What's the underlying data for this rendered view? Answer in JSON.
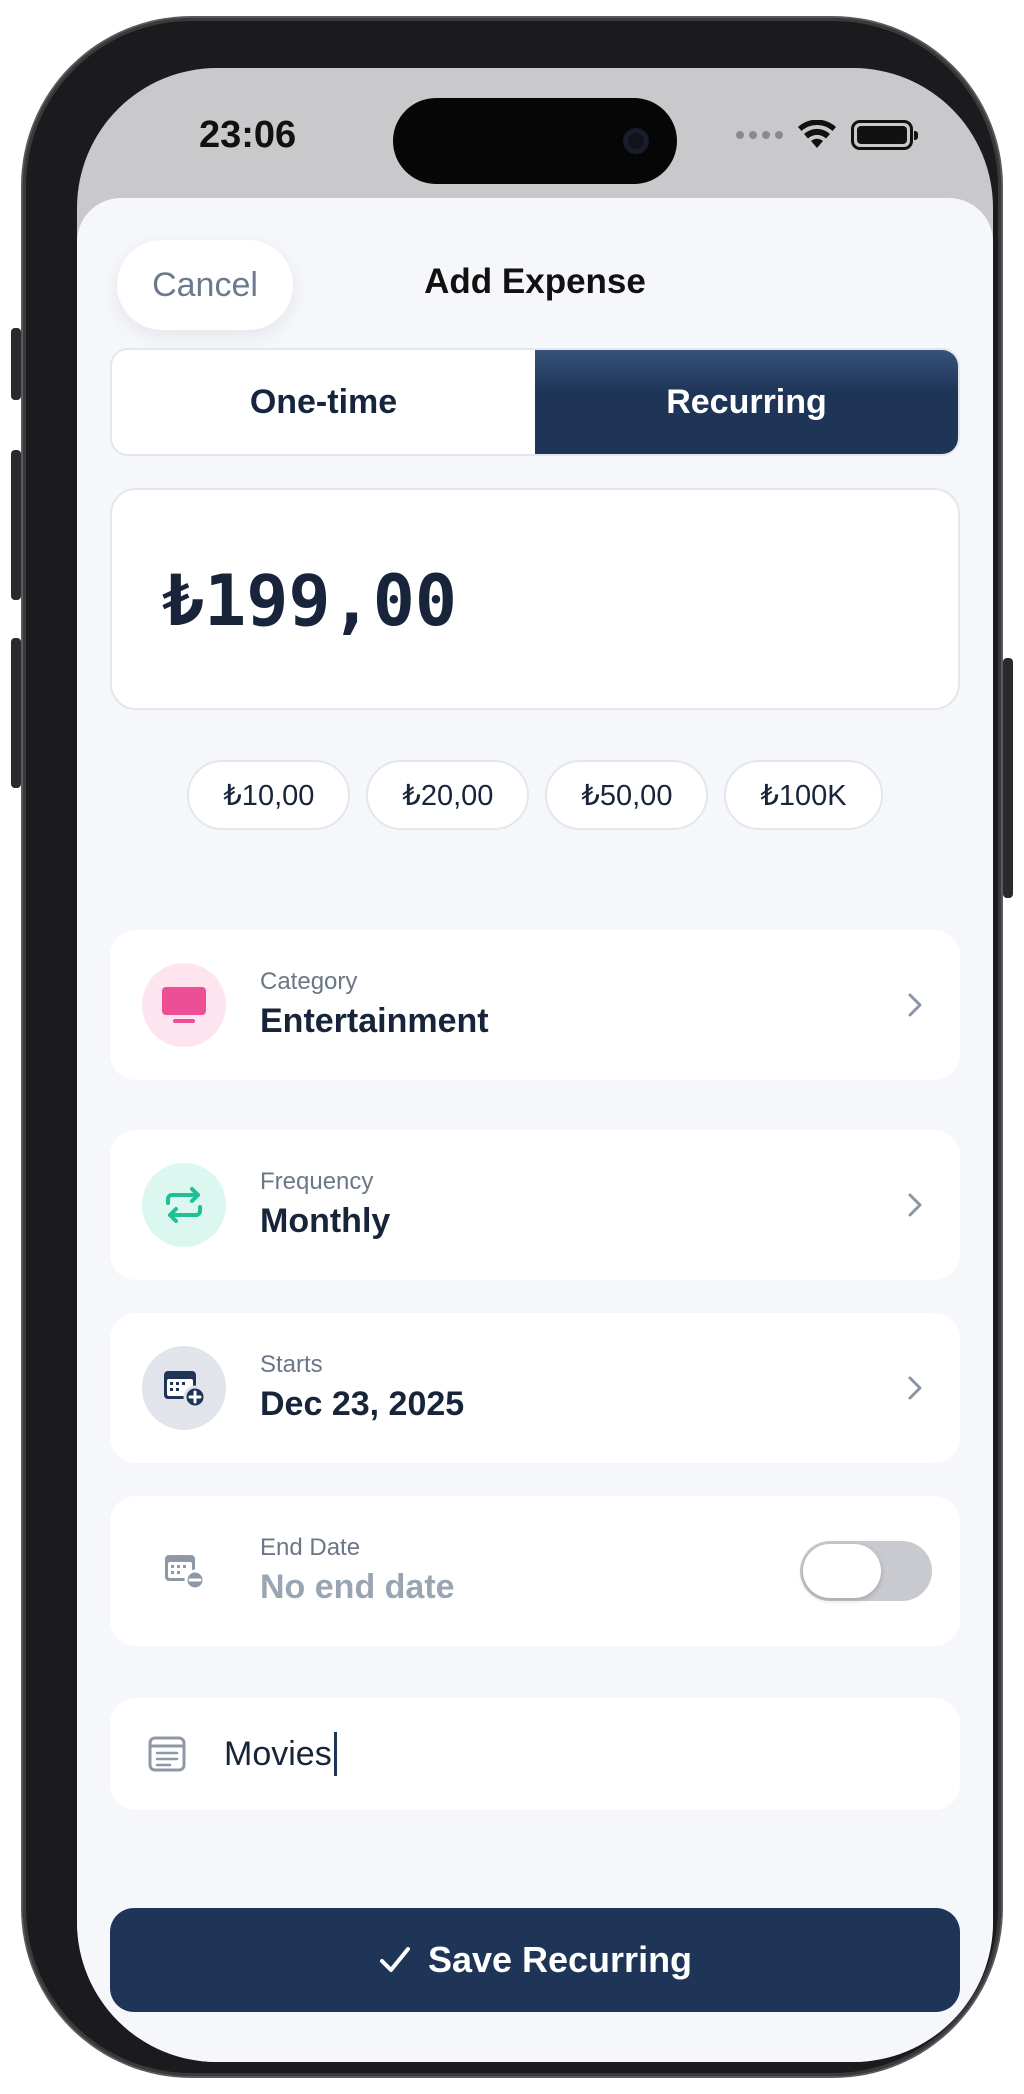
{
  "status_bar": {
    "time": "23:06"
  },
  "header": {
    "cancel_label": "Cancel",
    "title": "Add Expense"
  },
  "segmented": {
    "options": [
      "One-time",
      "Recurring"
    ],
    "selected": "Recurring"
  },
  "amount": {
    "value": "₺199,00"
  },
  "quick_amounts": [
    "₺10,00",
    "₺20,00",
    "₺50,00",
    "₺100K"
  ],
  "rows": {
    "category": {
      "label": "Category",
      "value": "Entertainment",
      "icon": "tv-icon",
      "color": "#ec4f96",
      "bg": "#fde4ef"
    },
    "frequency": {
      "label": "Frequency",
      "value": "Monthly",
      "icon": "repeat-icon",
      "color": "#1fbf97",
      "bg": "#dcf7ef"
    },
    "starts": {
      "label": "Starts",
      "value": "Dec 23, 2025",
      "icon": "calendar-add-icon",
      "color": "#1e3558",
      "bg": "#e1e4ea"
    },
    "end_date": {
      "label": "End Date",
      "value": "No end date",
      "icon": "calendar-remove-icon",
      "toggle_on": false
    }
  },
  "note": {
    "value": "Movies",
    "icon": "note-icon"
  },
  "save": {
    "label": "Save Recurring",
    "icon": "checkmark-icon"
  },
  "colors": {
    "primary": "#1e3558",
    "sheet_bg": "#f5f7fa"
  }
}
